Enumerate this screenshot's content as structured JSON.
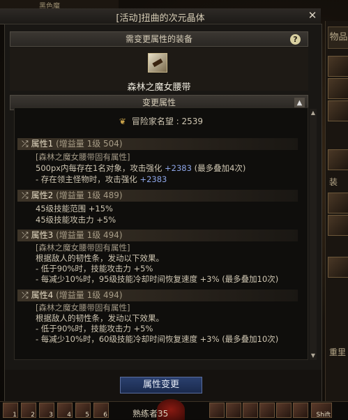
{
  "window": {
    "title": "[活动]扭曲的次元晶体",
    "close_glyph": "✕"
  },
  "top_left": "黑色魔",
  "equipment": {
    "header": "需变更属性的装备",
    "help_glyph": "?",
    "item_name": "森林之魔女腰带",
    "icon": "belt-icon"
  },
  "change_section": {
    "header": "变更属性",
    "collapse_glyph": "▲",
    "fame_label": "冒险家名望",
    "fame_value": "2539"
  },
  "attributes": [
    {
      "title": "属性1",
      "level": "(增益量 1级 504)",
      "lines": [
        {
          "text": "[森林之魔女腰带固有属性]",
          "dim": true
        },
        {
          "text": "500px内每存在1名对象，攻击强化 ",
          "bonus": "+2383",
          "suffix": " (最多叠加4次)"
        },
        {
          "text": "- 存在领主怪物时，攻击强化 ",
          "bonus": "+2383",
          "suffix": ""
        }
      ]
    },
    {
      "title": "属性2",
      "level": "(增益量 1级 489)",
      "lines": [
        {
          "text": "45级技能范围 +15%"
        },
        {
          "text": "45级技能攻击力 +5%"
        }
      ]
    },
    {
      "title": "属性3",
      "level": "(增益量 1级 494)",
      "lines": [
        {
          "text": "[森林之魔女腰带固有属性]",
          "dim": true
        },
        {
          "text": "根据敌人的韧性条，发动以下效果。"
        },
        {
          "text": "- 低于90%时，技能攻击力 +5%"
        },
        {
          "text": "- 每减少10%时，95级技能冷却时间恢复速度 +3% (最多叠加10次)"
        }
      ]
    },
    {
      "title": "属性4",
      "level": "(增益量 1级 494)",
      "lines": [
        {
          "text": "[森林之魔女腰带固有属性]",
          "dim": true
        },
        {
          "text": "根据敌人的韧性条，发动以下效果。"
        },
        {
          "text": "- 低于90%时，技能攻击力 +5%"
        },
        {
          "text": "- 每减少10%时，60级技能冷却时间恢复速度 +3% (最多叠加10次)"
        }
      ]
    }
  ],
  "button": {
    "label": "属性变更"
  },
  "right_panel": {
    "tab_label": "物品",
    "section_label": "装",
    "weight_label": "重里"
  },
  "skillbar": {
    "keys": [
      "1",
      "2",
      "3",
      "4",
      "5",
      "6"
    ],
    "status_text": "熟练者35",
    "right_keys": [
      "Shift"
    ]
  },
  "colors": {
    "bonus_blue": "#8ea6e8",
    "button_blue": "#2a3f6e"
  }
}
